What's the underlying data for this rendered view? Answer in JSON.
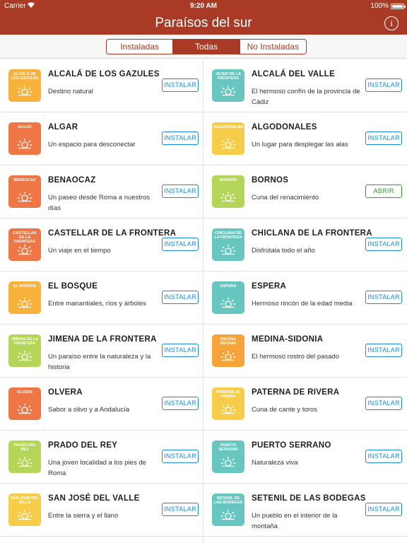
{
  "status": {
    "carrier": "Carrier",
    "time": "9:20 AM",
    "battery": "100%"
  },
  "nav": {
    "title": "Paraísos del sur",
    "info_symbol": "i"
  },
  "segments": [
    {
      "label": "Instaladas",
      "active": false
    },
    {
      "label": "Todas",
      "active": true
    },
    {
      "label": "No Instaladas",
      "active": false
    }
  ],
  "colors": {
    "brand": "#a83a26",
    "button_blue": "#1e88d8",
    "button_green": "#2e9b2e"
  },
  "rows": [
    {
      "left": {
        "logo_label": "ALCALÁ DE LOS GAZULES",
        "logo_color": "#f8b13a",
        "name": "ALCALÁ DE LOS GAZULES",
        "description": "Destino natural",
        "button": "INSTALAR"
      },
      "right": {
        "logo_label": "VEJER DE LA FRONTERA",
        "logo_color": "#67c7c0",
        "name": "ALCALÁ DEL VALLE",
        "description": "El hermoso confín de la provincia de Cádiz",
        "button": "INSTALAR"
      }
    },
    {
      "left": {
        "logo_label": "ALGAR",
        "logo_color": "#ef7747",
        "name": "ALGAR",
        "description": "Un espacio para desconectar",
        "button": "INSTALAR"
      },
      "right": {
        "logo_label": "ALGODONALES",
        "logo_color": "#f6cc48",
        "name": "ALGODONALES",
        "description": "Un lugar para desplegar las alas",
        "button": "INSTALAR"
      }
    },
    {
      "left": {
        "logo_label": "BENAOCAZ",
        "logo_color": "#ef7747",
        "name": "BENAOCAZ",
        "description": "Un paseo desde Roma a nuestros días",
        "button": "INSTALAR"
      },
      "right": {
        "logo_label": "BORNOS",
        "logo_color": "#b5d558",
        "name": "BORNOS",
        "description": "Cuna del renacimiento",
        "button": "ABRIR"
      }
    },
    {
      "left": {
        "logo_label": "CASTELLAR DE LA FRONTERA",
        "logo_color": "#ef7747",
        "name": "CASTELLAR DE LA FRONTERA",
        "description": "Un viaje en el tiempo",
        "button": "INSTALAR"
      },
      "right": {
        "logo_label": "CHICLANA DE LA FRONTERA",
        "logo_color": "#67c7c0",
        "name": "CHICLANA DE LA FRONTERA",
        "description": "Disfrútala todo el año",
        "button": "INSTALAR"
      }
    },
    {
      "left": {
        "logo_label": "EL BOSQUE",
        "logo_color": "#f8b13a",
        "name": "EL BOSQUE",
        "description": "Entre manantiales, ríos y árboles",
        "button": "INSTALAR"
      },
      "right": {
        "logo_label": "ESPERA",
        "logo_color": "#67c7c0",
        "name": "ESPERA",
        "description": "Hermoso rincón de la edad media",
        "button": "INSTALAR"
      }
    },
    {
      "left": {
        "logo_label": "JIMENA DE LA FRONTERA",
        "logo_color": "#b5d558",
        "name": "JIMENA DE LA FRONTERA",
        "description": "Un paraíso entre la naturaleza y la historia",
        "button": "INSTALAR"
      },
      "right": {
        "logo_label": "MEDINA SIDONIA",
        "logo_color": "#f6a43a",
        "name": "MEDINA-SIDONIA",
        "description": "El hermoso rostro del pasado",
        "button": "INSTALAR"
      }
    },
    {
      "left": {
        "logo_label": "OLVERA",
        "logo_color": "#ef7747",
        "name": "OLVERA",
        "description": "Sabor a olivo y a Andalucía",
        "button": "INSTALAR"
      },
      "right": {
        "logo_label": "PATERNA DE RIVERA",
        "logo_color": "#f6cc48",
        "name": "PATERNA DE RIVERA",
        "description": "Cuna de cante y toros",
        "button": "INSTALAR"
      }
    },
    {
      "left": {
        "logo_label": "PRADO DEL REY",
        "logo_color": "#b5d558",
        "name": "PRADO DEL REY",
        "description": "Una joven localidad a los pies de Roma",
        "button": "INSTALAR"
      },
      "right": {
        "logo_label": "PUERTO SERRANO",
        "logo_color": "#67c7c0",
        "name": "PUERTO SERRANO",
        "description": "Naturaleza viva",
        "button": "INSTALAR"
      }
    },
    {
      "left": {
        "logo_label": "SAN JOSÉ DEL VALLE",
        "logo_color": "#f6cc48",
        "name": "SAN JOSÉ DEL VALLE",
        "description": "Entre la sierra y el llano",
        "button": "INSTALAR"
      },
      "right": {
        "logo_label": "SETENIL DE LAS BODEGAS",
        "logo_color": "#67c7c0",
        "name": "SETENIL DE LAS BODEGAS",
        "description": "Un pueblo en el interior de la montaña",
        "button": "INSTALAR"
      }
    }
  ]
}
